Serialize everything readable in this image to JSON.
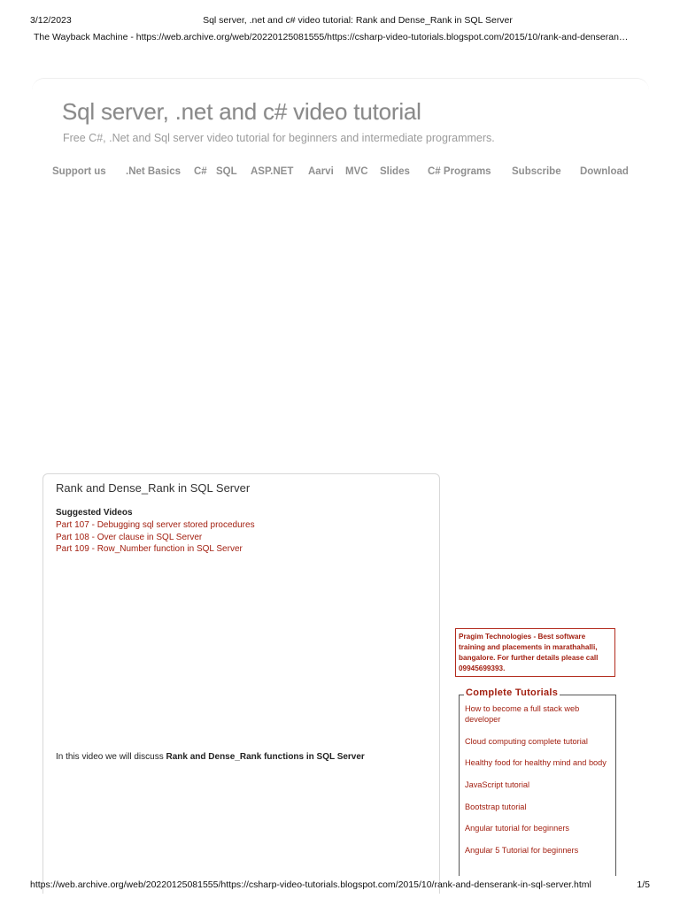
{
  "print_header": {
    "date": "3/12/2023",
    "title": "Sql server, .net and c# video tutorial: Rank and Dense_Rank in SQL Server"
  },
  "wayback": "The Wayback Machine - https://web.archive.org/web/20220125081555/https://csharp-video-tutorials.blogspot.com/2015/10/rank-and-denseran…",
  "blog": {
    "title": "Sql server, .net and c# video tutorial",
    "description": "Free C#, .Net and Sql server video tutorial for beginners and intermediate programmers."
  },
  "nav": [
    "Support us",
    ".Net Basics",
    "C#",
    "SQL",
    "ASP.NET",
    "Aarvi",
    "MVC",
    "Slides",
    "C# Programs",
    "Subscribe",
    "Download"
  ],
  "post": {
    "title": "Rank and Dense_Rank in SQL Server",
    "suggested_heading": "Suggested Videos",
    "suggested_links": [
      "Part 107 - Debugging sql server stored procedures",
      "Part 108 - Over clause in SQL Server",
      "Part 109 - Row_Number function in SQL Server"
    ],
    "intro_prefix": "In this video we will discuss ",
    "intro_bold": "Rank and Dense_Rank functions in SQL Server"
  },
  "promo": "Pragim Technologies - Best software training and placements in marathahalli, bangalore. For further details please call 09945699393.",
  "tutorials": {
    "heading": "Complete Tutorials",
    "items": [
      "How to become a full stack web developer",
      "Cloud computing complete tutorial",
      "Healthy food for healthy mind and body",
      "JavaScript tutorial",
      "Bootstrap tutorial",
      "Angular tutorial for beginners",
      "Angular 5 Tutorial for beginners"
    ]
  },
  "print_footer": {
    "url": "https://web.archive.org/web/20220125081555/https://csharp-video-tutorials.blogspot.com/2015/10/rank-and-denserank-in-sql-server.html",
    "page": "1/5"
  },
  "colors": {
    "link": "#a21f10",
    "title_gray": "#8a8a8a",
    "nav_gray": "#8f8f8f"
  }
}
